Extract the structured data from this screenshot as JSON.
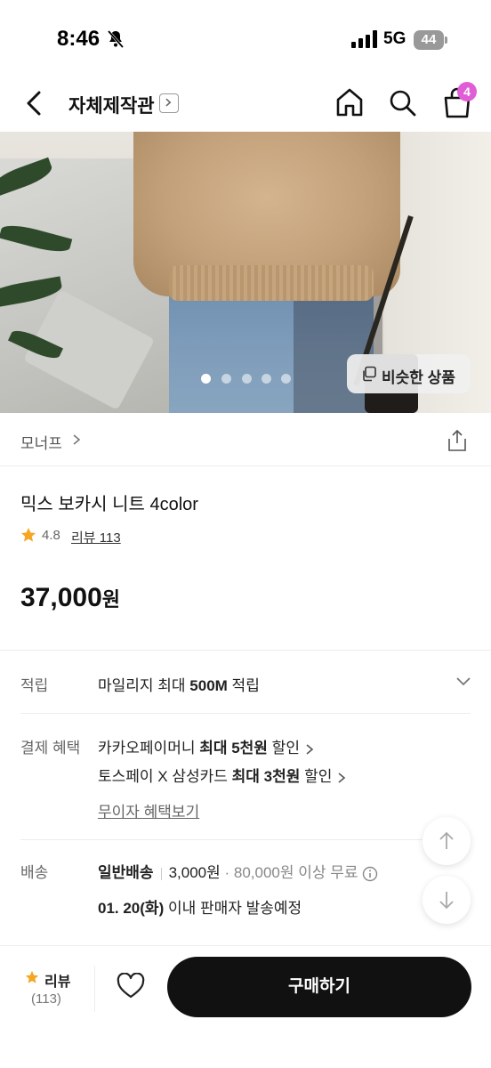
{
  "status_bar": {
    "time": "8:46",
    "network": "5G",
    "battery": "44"
  },
  "nav": {
    "shop_title": "자체제작관",
    "cart_count": "4"
  },
  "hero": {
    "similar_label": "비슷한 상품",
    "slide_count": 5,
    "active_slide": 1
  },
  "brand": {
    "name": "모너프"
  },
  "product": {
    "name": "믹스 보카시 니트 4color",
    "rating": "4.8",
    "review_link": "리뷰 113",
    "price": "37,000",
    "price_unit": "원"
  },
  "points": {
    "label": "적립",
    "text_prefix": "마일리지 최대 ",
    "text_bold": "500M",
    "text_suffix": " 적립"
  },
  "payment": {
    "label": "결제 혜택",
    "line1_prefix": "카카오페이머니 ",
    "line1_bold": "최대 5천원",
    "line1_suffix": " 할인",
    "line2_prefix": "토스페이 X 삼성카드 ",
    "line2_bold": "최대 3천원",
    "line2_suffix": " 할인",
    "installment_link": "무이자 혜택보기"
  },
  "shipping": {
    "label": "배송",
    "type": "일반배송",
    "fee": "3,000원",
    "free_condition": "· 80,000원 이상 무료",
    "date_bold": "01. 20(화)",
    "date_suffix": " 이내 판매자 발송예정"
  },
  "bottom_bar": {
    "review_label": "리뷰",
    "review_count": "(113)",
    "buy_label": "구매하기"
  },
  "colors": {
    "accent_badge": "#e05dd6",
    "star": "#f5a623",
    "buy_button": "#111111"
  }
}
